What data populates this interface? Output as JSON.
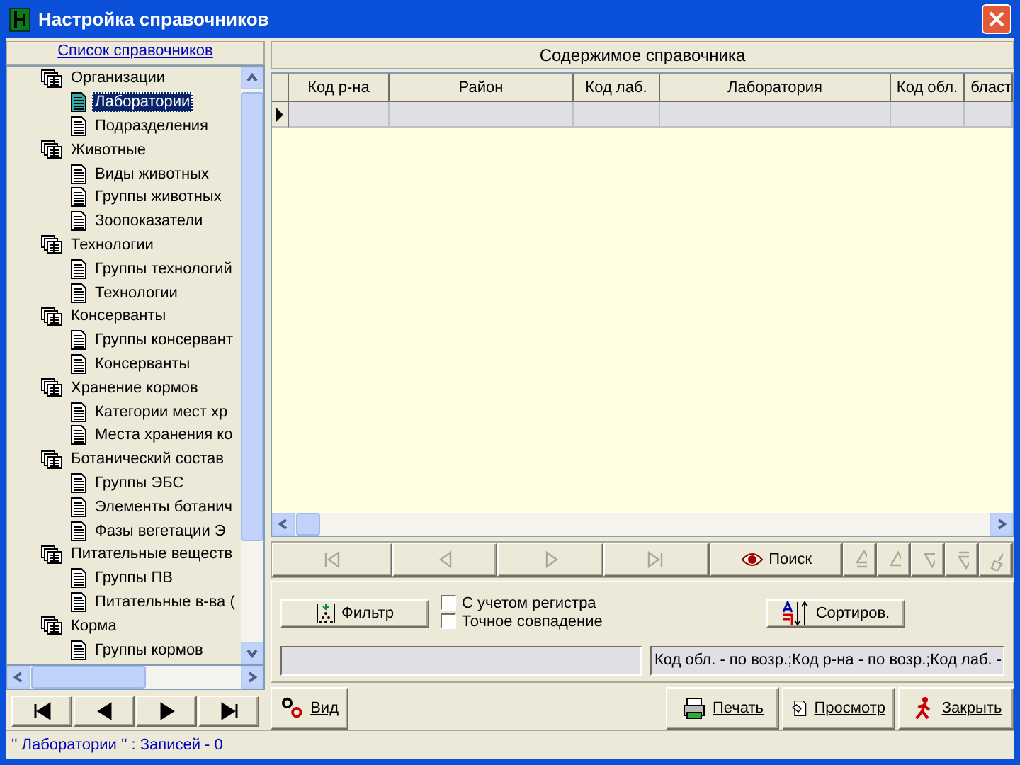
{
  "window": {
    "title": "Настройка справочников"
  },
  "sidebar": {
    "title": "Список справочников",
    "items": [
      {
        "label": "Организации",
        "children": [
          {
            "label": "Лаборатории",
            "selected": true
          },
          {
            "label": "Подразделения",
            "selected": false
          }
        ]
      },
      {
        "label": "Животные",
        "children": [
          {
            "label": "Виды животных",
            "selected": false
          },
          {
            "label": "Группы животных",
            "selected": false
          },
          {
            "label": "Зоопоказатели",
            "selected": false
          }
        ]
      },
      {
        "label": "Технологии",
        "children": [
          {
            "label": "Группы технологий",
            "selected": false
          },
          {
            "label": "Технологии",
            "selected": false
          }
        ]
      },
      {
        "label": "Консерванты",
        "children": [
          {
            "label": "Группы консервант",
            "selected": false
          },
          {
            "label": "Консерванты",
            "selected": false
          }
        ]
      },
      {
        "label": "Хранение кормов",
        "children": [
          {
            "label": "Категории мест хр",
            "selected": false
          },
          {
            "label": "Места хранения ко",
            "selected": false
          }
        ]
      },
      {
        "label": "Ботанический состав",
        "children": [
          {
            "label": "Группы ЭБС",
            "selected": false
          },
          {
            "label": "Элементы ботанич",
            "selected": false
          },
          {
            "label": "Фазы вегетации Э",
            "selected": false
          }
        ]
      },
      {
        "label": "Питательные веществ",
        "children": [
          {
            "label": "Группы ПВ",
            "selected": false
          },
          {
            "label": "Питательные в-ва (",
            "selected": false
          }
        ]
      },
      {
        "label": "Корма",
        "children": [
          {
            "label": "Группы кормов",
            "selected": false
          }
        ]
      }
    ]
  },
  "content": {
    "title": "Содержимое справочника",
    "table": {
      "columns": [
        "Код р-на",
        "Район",
        "Код лаб.",
        "Лаборатория",
        "Код обл.",
        "бласт"
      ]
    },
    "toolbar": [
      {
        "kind": "first",
        "disabled": true
      },
      {
        "kind": "prev",
        "disabled": true
      },
      {
        "kind": "next",
        "disabled": true
      },
      {
        "kind": "last",
        "disabled": true
      },
      {
        "kind": "search",
        "label": "Поиск",
        "disabled": false
      },
      {
        "kind": "up-first",
        "disabled": true
      },
      {
        "kind": "up",
        "disabled": true
      },
      {
        "kind": "down",
        "disabled": true
      },
      {
        "kind": "down-last",
        "disabled": true
      },
      {
        "kind": "clear",
        "disabled": true
      }
    ],
    "filter_button": "Фильтр",
    "options": [
      {
        "label": "С учетом регистра",
        "checked": false
      },
      {
        "label": "Точное совпадение",
        "checked": false
      }
    ],
    "sort_button": "Сортиров.",
    "sort_order": "Код обл. - по возр.;Код р-на - по возр.;Код лаб. -"
  },
  "buttons": [
    {
      "kind": "view",
      "label": "Вид"
    },
    {
      "kind": "print",
      "label": "Печать"
    },
    {
      "kind": "preview",
      "label": "Просмотр"
    },
    {
      "kind": "close",
      "label": "Закрыть"
    }
  ],
  "status_bar": "'' Лаборатории '' : Записей - 0"
}
